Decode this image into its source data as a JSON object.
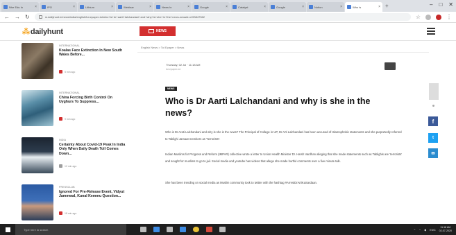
{
  "browser": {
    "tabs": [
      {
        "label": "Nhe Edu In",
        "active": false
      },
      {
        "label": "IPO",
        "active": false
      },
      {
        "label": "Lithium",
        "active": false
      },
      {
        "label": "Webinar",
        "active": false
      },
      {
        "label": "News In",
        "active": false
      },
      {
        "label": "Google",
        "active": false
      },
      {
        "label": "Catalyst",
        "active": false
      },
      {
        "label": "Google",
        "active": false
      },
      {
        "label": "Notion",
        "active": false
      },
      {
        "label": "Who is",
        "active": true
      }
    ],
    "url": "m.dailyhunt.in/news/india/english/toi-epaper-toi/who+is+dr+aarti+lalchandani+and+why+is+she+in+the+news-newsid-n193847362"
  },
  "site": {
    "logo_text": "dailyhunt",
    "news_badge": "NEWS"
  },
  "sidebar": {
    "items": [
      {
        "category": "INTERNATIONAL",
        "title": "Koalas Face Extinction In New South Wales Before...",
        "time": "5 min ago",
        "thumb": "koala"
      },
      {
        "category": "INTERNATIONAL",
        "title": "China Forcing Birth Control On Uyghurs To Suppress...",
        "time": "9 min ago",
        "thumb": "medical"
      },
      {
        "category": "INDIA",
        "title": "Certainty About Covid-19 Peak In India Only When Daily Death Toll Comes Down...",
        "time": "12 min ago",
        "thumb": "ppe"
      },
      {
        "category": "PRESSCLUB",
        "title": "Ignored For Pre-Release Event, Vidyut Jammwal, Kunal Kemmu Question...",
        "time": "18 min ago",
        "thumb": "portrait"
      }
    ]
  },
  "main": {
    "breadcrumb": "English News > Toi Epaper > News",
    "dateline": "Thursday, 02 Jul · 11:18 AM",
    "source": "toi-epaper-toi",
    "tag": "NEWS",
    "headline": "Who is Dr Aarti Lalchandani and why is she in the news?",
    "paragraphs": [
      "Who is Dr Arati Lalchandani and why is she in the news? The Principal of College in UP, Dr Arti Lalchandani has been accused of Islamophobic statements and she purportedly referred to Tablighi Jamaat members as \"terrorists\".",
      "Indian Muslims for Progress and Reform (IMPAR) collective wrote a letter to Union Health Minister Dr. Harsh Vardhan alleging that she made statements such as Tablighis are 'terrorists' and sought for muslims to go to jail. Social media and youtube has videos that allege she made hurtful comments over a five minute talk.",
      "She has been trending on social media as Muslim community took to twitter with the hashtag #ArrestDrArtiKaSardaan."
    ]
  },
  "share": {
    "facebook": "f",
    "twitter": "t",
    "email": "✉"
  },
  "taskbar": {
    "search_placeholder": "Type here to search",
    "tray_lang": "ENG",
    "clock_time": "11:18 AM",
    "clock_date": "02-07-2020"
  }
}
